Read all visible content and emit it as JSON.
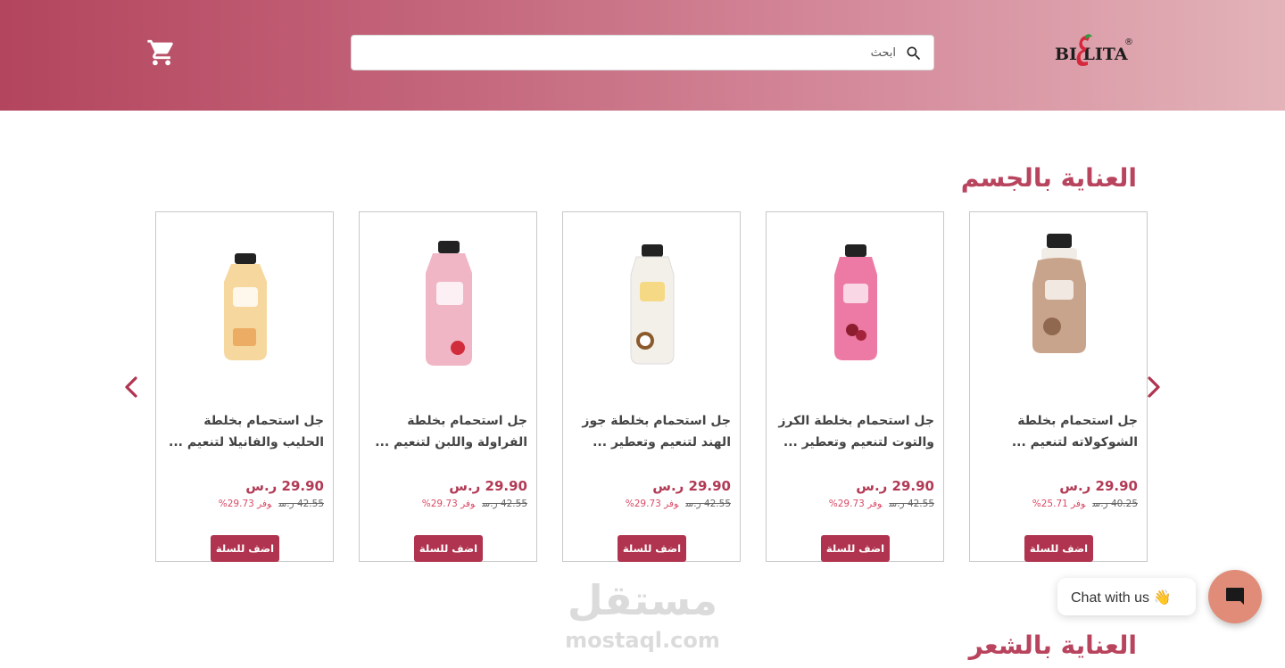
{
  "header": {
    "logo_text": "BI  LITA",
    "logo_reg": "®",
    "search_placeholder": "ابحث",
    "icons": [
      "cart-icon",
      "search-icon"
    ]
  },
  "sections": [
    {
      "title": "العناية بالجسم"
    },
    {
      "title": "العناية بالشعر"
    }
  ],
  "products": [
    {
      "name": "جل استحمام بخلطة الشوكولاته لتنعيم ...",
      "price": "29.90 ر.س",
      "old_price": "40.25 ر.س",
      "save": "وفر 25.71%",
      "button": "اضف للسلة",
      "bottle_color": "#c9a48c"
    },
    {
      "name": "جل استحمام بخلطة الكرز والتوت لتنعيم وتعطير ...",
      "price": "29.90 ر.س",
      "old_price": "42.55 ر.س",
      "save": "وفر 29.73%",
      "button": "اضف للسلة",
      "bottle_color": "#ec7aa5"
    },
    {
      "name": "جل استحمام بخلطة جوز الهند لتنعيم وتعطير ...",
      "price": "29.90 ر.س",
      "old_price": "42.55 ر.س",
      "save": "وفر 29.73%",
      "button": "اضف للسلة",
      "bottle_color": "#f3f0ea"
    },
    {
      "name": "جل استحمام بخلطة الفراولة واللبن لتنعيم ...",
      "price": "29.90 ر.س",
      "old_price": "42.55 ر.س",
      "save": "وفر 29.73%",
      "button": "اضف للسلة",
      "bottle_color": "#f1b6c6"
    },
    {
      "name": "جل استحمام بخلطة الحليب والفانيلا لتنعيم ...",
      "price": "29.90 ر.س",
      "old_price": "42.55 ر.س",
      "save": "وفر 29.73%",
      "button": "اضف للسلة",
      "bottle_color": "#f6d79e"
    }
  ],
  "watermark": {
    "arabic": "مستقل",
    "latin": "mostaql.com"
  },
  "chat": {
    "label": "Chat with us 👋"
  },
  "colors": {
    "brand": "#b0344f",
    "title": "#b8445e",
    "chat": "#e08c78"
  }
}
